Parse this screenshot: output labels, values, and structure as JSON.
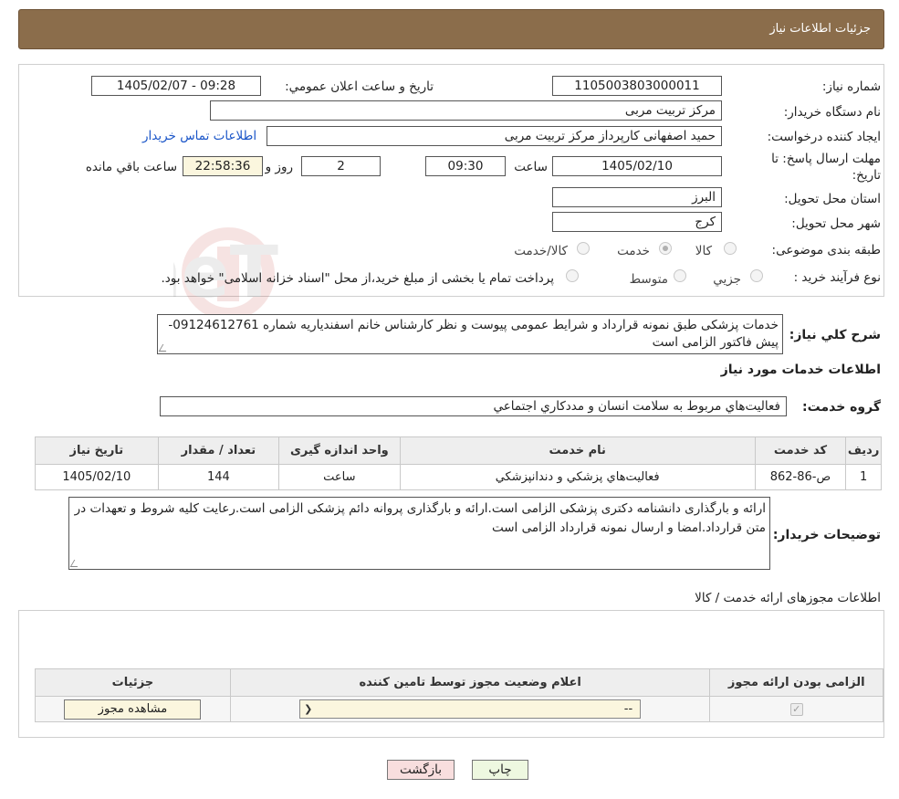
{
  "header": {
    "title": "جزئیات اطلاعات نیاز"
  },
  "form": {
    "need_number_label": "شماره نیاز:",
    "need_number": "1105003803000011",
    "announce_label": "تاريخ و ساعت اعلان عمومي:",
    "announce_value": "1405/02/07 - 09:28",
    "buyer_org_label": "نام دستگاه خريدار:",
    "buyer_org": "مرکز تربیت مربی",
    "requester_label": "ايجاد کننده درخواست:",
    "requester": "حمید اصفهانی کارپرداز مرکز تربیت مربی",
    "contact_link": "اطلاعات تماس خريدار",
    "deadline_label": "مهلت ارسال پاسخ: تا تاريخ:",
    "deadline_date": "1405/02/10",
    "time_label": "ساعت",
    "deadline_time": "09:30",
    "days_value": "2",
    "days_label": "روز و",
    "remaining_time": "22:58:36",
    "remaining_label": "ساعت باقي مانده",
    "province_label": "استان محل تحويل:",
    "province": "البرز",
    "city_label": "شهر محل تحويل:",
    "city": "کرج",
    "category_label": "طبقه بندی موضوعی:",
    "category_options": [
      "کالا",
      "خدمت",
      "کالا/خدمت"
    ],
    "category_selected": "خدمت",
    "purchase_type_label": "نوع فرآيند خريد :",
    "purchase_options": [
      "جزيي",
      "متوسط"
    ],
    "purchase_note": "پرداخت تمام يا بخشی از مبلغ خريد،از محل \"اسناد خزانه اسلامی\" خواهد بود."
  },
  "description": {
    "label": "شرح کلي نياز:",
    "text": "خدمات پزشکی طبق نمونه قرارداد و شرایط عمومی پیوست و نظر کارشناس خانم اسفندیاریه شماره 09124612761- پیش فاکتور الزامی است"
  },
  "services": {
    "title": "اطلاعات خدمات مورد نياز",
    "group_label": "گروه خدمت:",
    "group_value": "فعاليت‌هاي مربوط به سلامت انسان و مددکاري اجتماعي",
    "columns": [
      "رديف",
      "کد خدمت",
      "نام خدمت",
      "واحد اندازه گيری",
      "تعداد / مقدار",
      "تاريخ نياز"
    ],
    "rows": [
      [
        "1",
        "ص-86-862",
        "فعاليت‌هاي پزشکي و دندانپزشکي",
        "ساعت",
        "144",
        "1405/02/10"
      ]
    ]
  },
  "buyer_notes": {
    "label": "توضيحات خريدار:",
    "text": "ارائه و بارگذاری دانشنامه دکتری پزشکی الزامی است.ارائه و بارگذاری پروانه دائم پزشکی الزامی است.رعایت کلیه شروط و تعهدات در متن قرارداد.امضا و ارسال نمونه قرارداد الزامی است"
  },
  "permits": {
    "title": "اطلاعات مجوزهای ارائه خدمت / کالا",
    "columns": [
      "الزامی بودن ارائه مجوز",
      "اعلام وضعیت مجوز توسط تامین کننده",
      "جزئیات"
    ],
    "select_value": "--",
    "view_button": "مشاهده مجوز"
  },
  "buttons": {
    "print": "چاپ",
    "back": "بازگشت"
  },
  "watermark": "AriaTender.neT",
  "colors": {
    "header": "#8b6d4b",
    "link": "#1a55c8",
    "back_button": "#f8dede",
    "print_button": "#eef8e0"
  }
}
